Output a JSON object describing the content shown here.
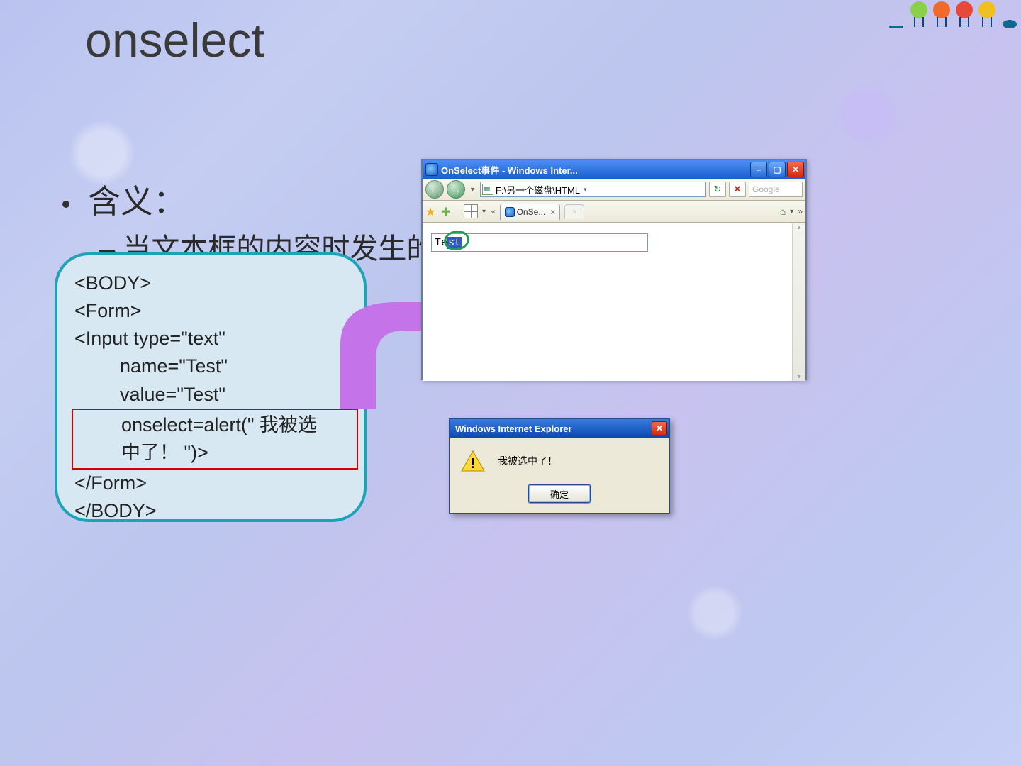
{
  "title": "onselect",
  "bullets": {
    "b1": "含义：",
    "b2": "– 当文本框的内容时发生的"
  },
  "code": {
    "l1": "<BODY>",
    "l2": "<Form>",
    "l3": "<Input type=\"text\"",
    "l4": "name=\"Test\"",
    "l5": "value=\"Test\"",
    "l6": "onselect=alert(\" 我被选",
    "l7": "中了！ \")>",
    "l8": "</Form>",
    "l9": "</BODY>"
  },
  "ie": {
    "title": "OnSelect事件 - Windows Inter...",
    "address": "F:\\另一个磁盘\\HTML",
    "search_placeholder": "Google",
    "tab_label": "OnSe...",
    "tab_close": "×",
    "chevrons": "«",
    "more": "»",
    "input_unselected": "Te",
    "input_selected": "st"
  },
  "alert": {
    "title": "Windows Internet Explorer",
    "message": "我被选中了！",
    "ok": "确定"
  }
}
